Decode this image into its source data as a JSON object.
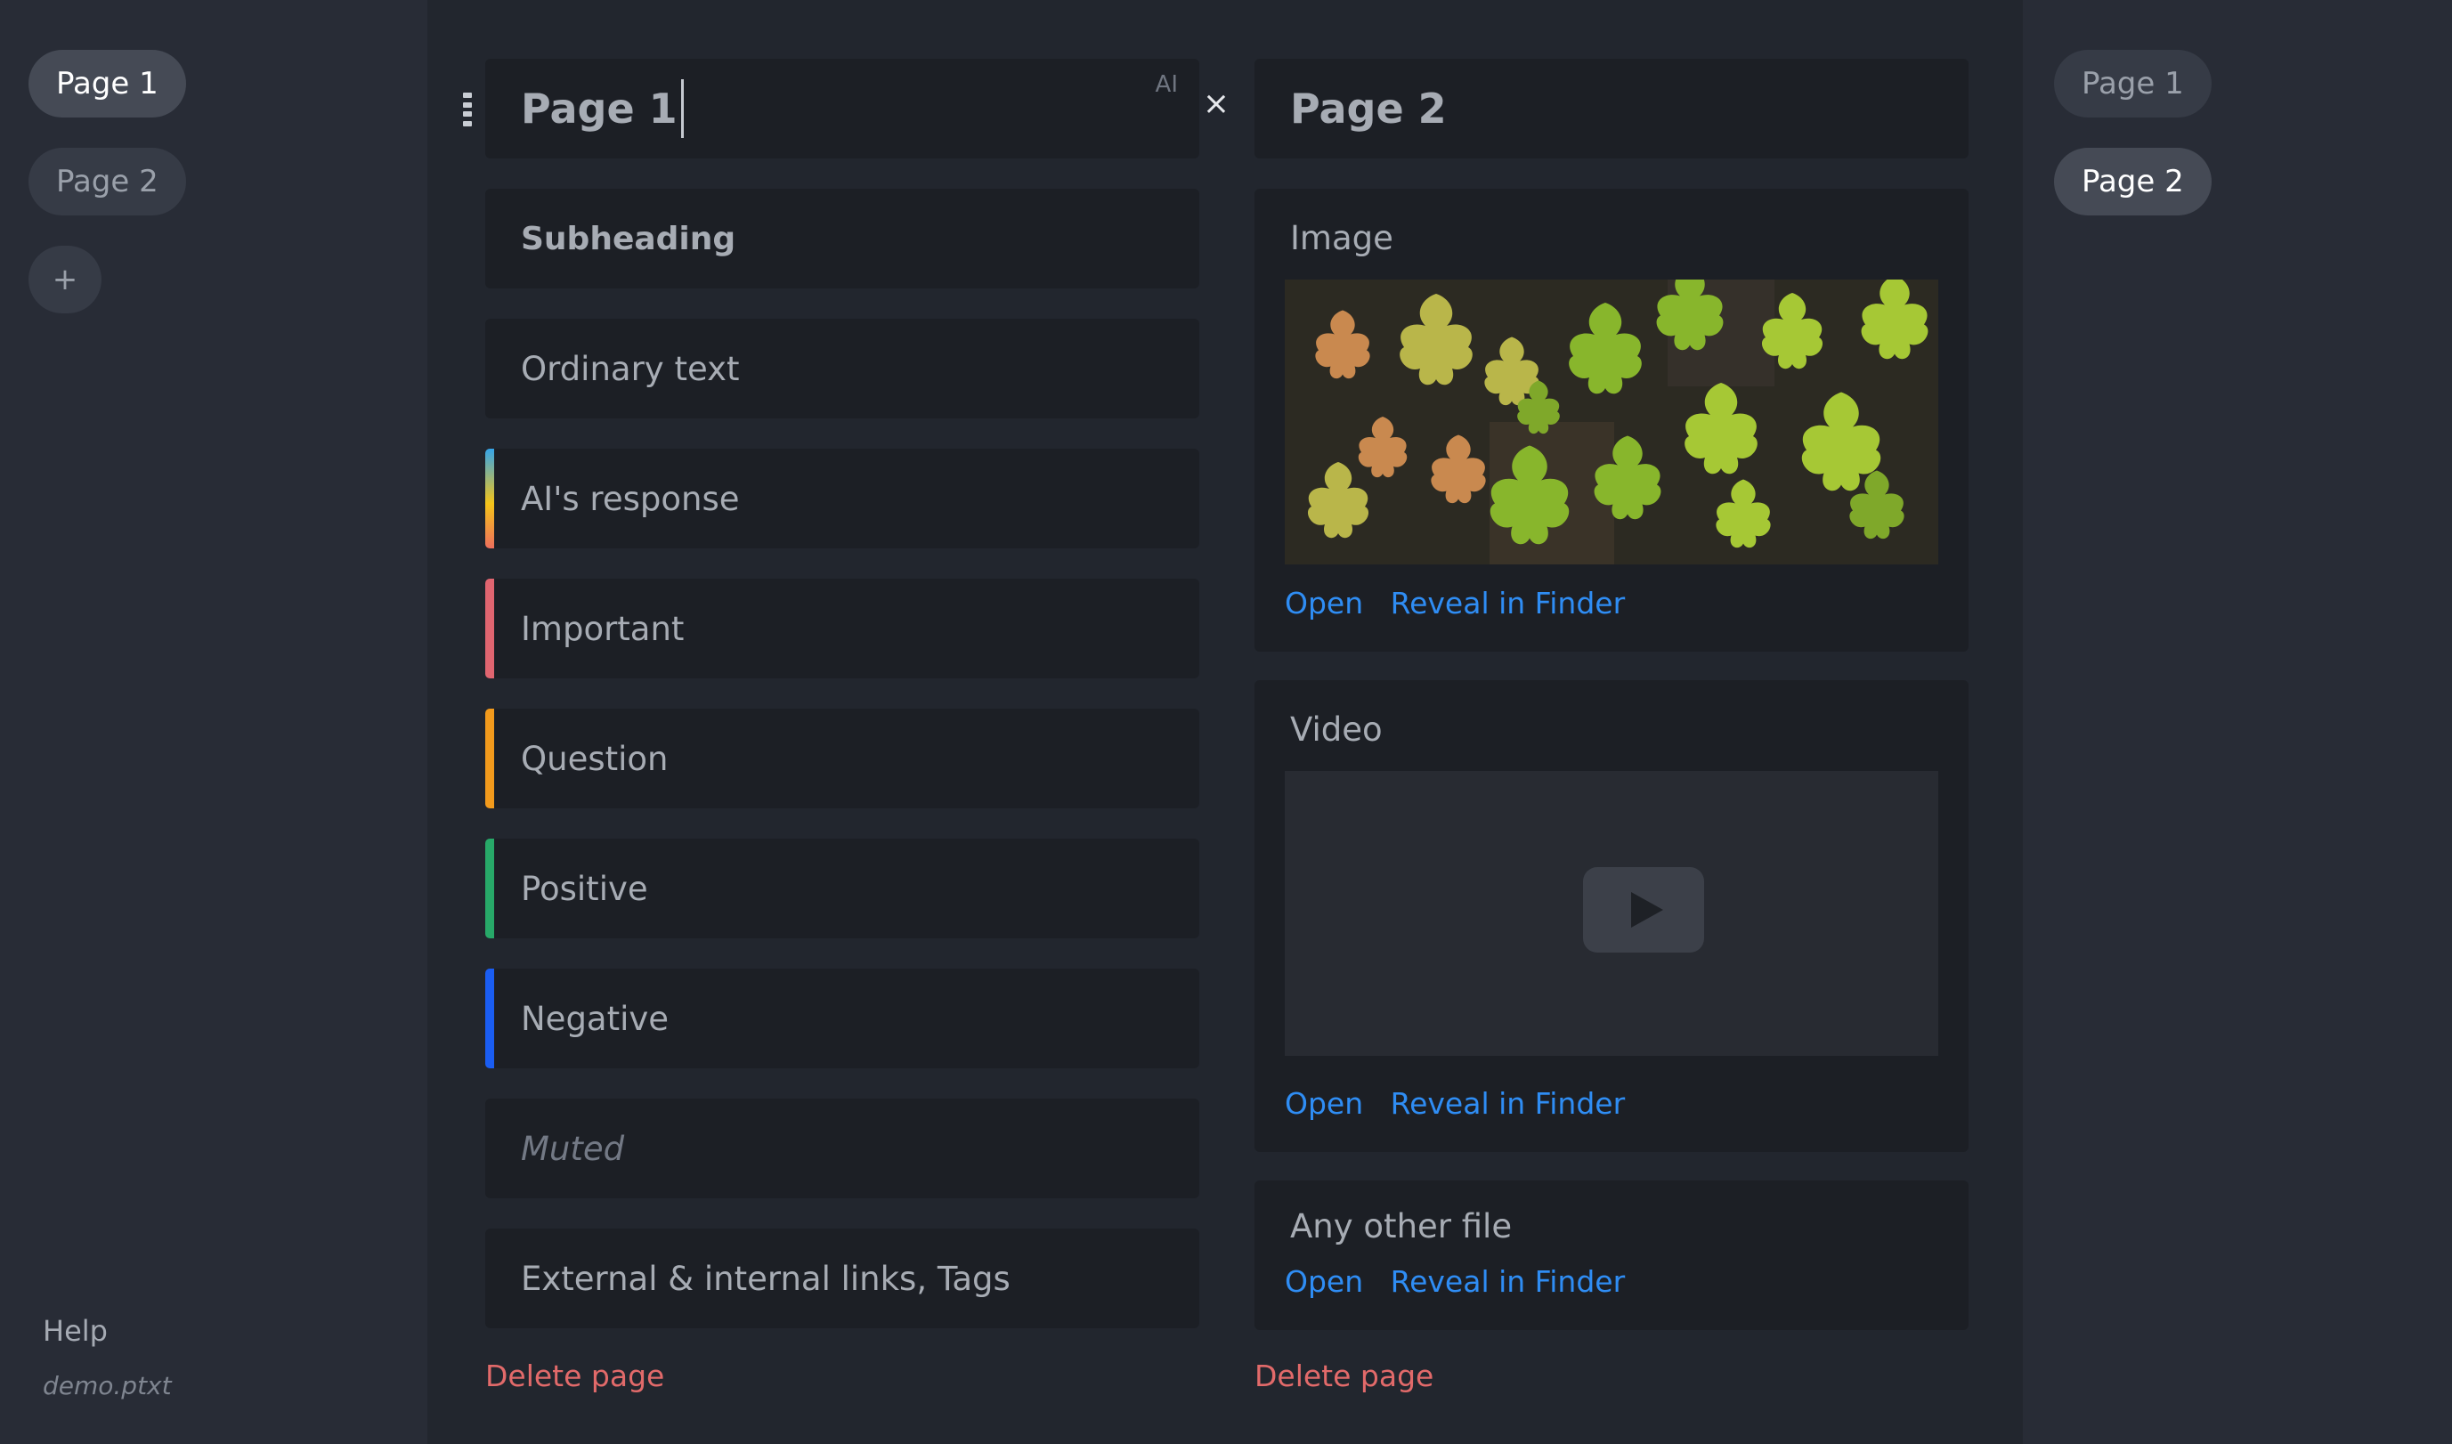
{
  "sidebar_left": {
    "pages": [
      "Page 1",
      "Page 2"
    ],
    "active_index": 0,
    "add_label": "+",
    "help_label": "Help",
    "filename": "demo.ptxt"
  },
  "sidebar_right": {
    "pages": [
      "Page 1",
      "Page 2"
    ],
    "active_index": 1
  },
  "page1": {
    "title": "Page 1",
    "ai_label": "AI",
    "blocks": [
      {
        "text": "Subheading",
        "style": "subheading"
      },
      {
        "text": "Ordinary text",
        "style": "normal"
      },
      {
        "text": "AI's response",
        "style": "ai",
        "accent": "gradient"
      },
      {
        "text": "Important",
        "style": "normal",
        "accent": "#e06570"
      },
      {
        "text": "Question",
        "style": "normal",
        "accent": "#f29a1c"
      },
      {
        "text": "Positive",
        "style": "normal",
        "accent": "#27a868"
      },
      {
        "text": "Negative",
        "style": "normal",
        "accent": "#1a5df2"
      },
      {
        "text": "Muted",
        "style": "muted"
      },
      {
        "text": "External & internal links, Tags",
        "style": "normal"
      }
    ],
    "delete_label": "Delete page"
  },
  "page2": {
    "title": "Page 2",
    "image_card": {
      "label": "Image",
      "open_label": "Open",
      "reveal_label": "Reveal in Finder"
    },
    "video_card": {
      "label": "Video",
      "open_label": "Open",
      "reveal_label": "Reveal in Finder"
    },
    "file_card": {
      "label": "Any other file",
      "open_label": "Open",
      "reveal_label": "Reveal in Finder"
    },
    "delete_label": "Delete page"
  },
  "colors": {
    "accent_link": "#2f8df4",
    "delete": "#e26a6a",
    "important": "#e06570",
    "question": "#f29a1c",
    "positive": "#27a868",
    "negative": "#1a5df2"
  }
}
